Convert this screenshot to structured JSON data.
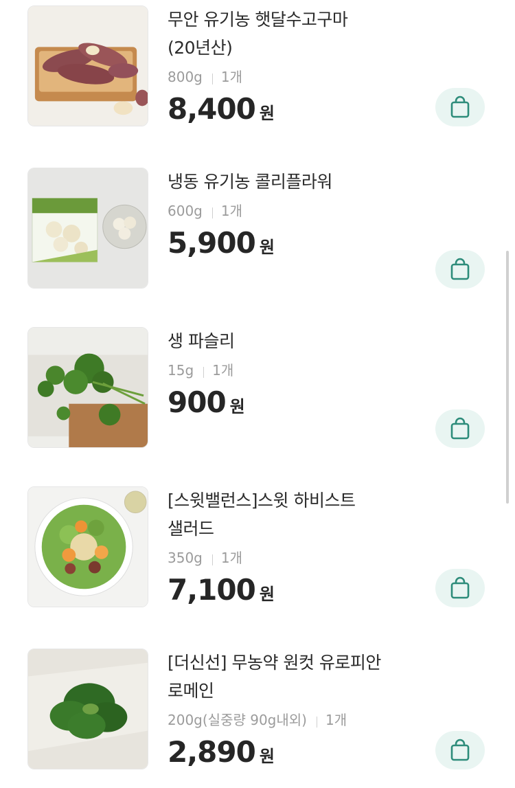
{
  "products": [
    {
      "name": "무안 유기농 햇달수고구마(20년산)",
      "weight": "800g",
      "count": "1개",
      "price": "8,400",
      "currency": "원",
      "image": "sweet-potato-photo"
    },
    {
      "name": "냉동 유기농 콜리플라워",
      "weight": "600g",
      "count": "1개",
      "price": "5,900",
      "currency": "원",
      "image": "frozen-cauliflower-photo"
    },
    {
      "name": "생 파슬리",
      "weight": "15g",
      "count": "1개",
      "price": "900",
      "currency": "원",
      "image": "parsley-photo"
    },
    {
      "name": "[스윗밸런스]스윗 하비스트 샐러드",
      "weight": "350g",
      "count": "1개",
      "price": "7,100",
      "currency": "원",
      "image": "salad-bowl-photo"
    },
    {
      "name": "[더신선] 무농약 원컷 유로피안 로메인",
      "weight": "200g(실중량 90g내외)",
      "count": "1개",
      "price": "2,890",
      "currency": "원",
      "image": "romaine-photo"
    }
  ],
  "icons": {
    "cart": "shopping-bag-icon"
  },
  "colors": {
    "cart_bg": "#e9f5f2",
    "cart_icon": "#2d8c7a"
  }
}
